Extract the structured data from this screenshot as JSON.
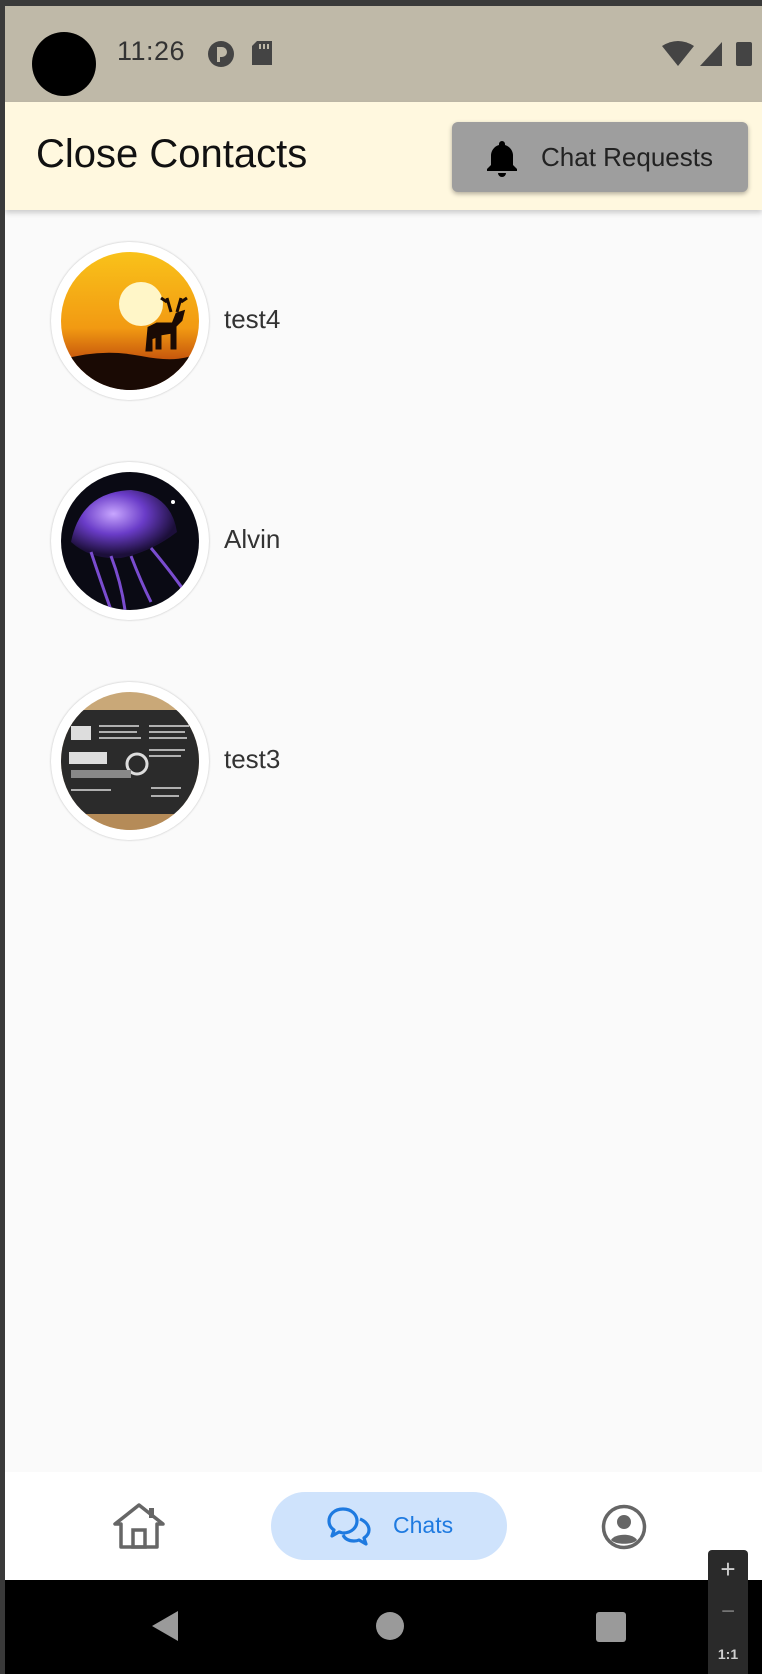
{
  "status_bar": {
    "time": "11:26"
  },
  "header": {
    "title": "Close Contacts",
    "chat_requests_label": "Chat Requests"
  },
  "contacts": [
    {
      "name": "test4"
    },
    {
      "name": "Alvin"
    },
    {
      "name": "test3"
    }
  ],
  "bottom_nav": {
    "chats_label": "Chats",
    "active": "chats"
  },
  "zoom": {
    "in": "+",
    "out": "−",
    "reset": "1:1"
  },
  "colors": {
    "status_bar": "#bfb9a8",
    "app_bar": "#fff8df",
    "chat_requests_button": "#9e9e9e",
    "active_nav_pill": "#cfe3fc",
    "active_nav_text": "#1e7ae0"
  }
}
